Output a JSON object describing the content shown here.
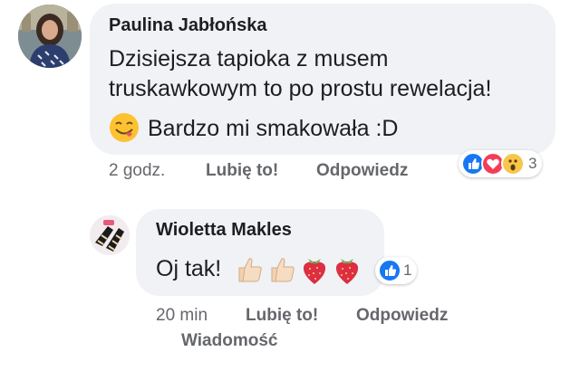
{
  "comment": {
    "author": "Paulina Jabłońska",
    "text_line1": "Dzisiejsza tapioka z musem",
    "text_line2": "truskawkowym to po prostu rewelacja!",
    "text_line3": "Bardzo mi smakowała :D",
    "time": "2 godz.",
    "like_label": "Lubię to!",
    "reply_label": "Odpowiedz",
    "reaction_count": "3",
    "reactions": [
      "like-icon",
      "love-icon",
      "wow-icon"
    ]
  },
  "reply": {
    "author": "Wioletta Makles",
    "text": "Oj tak!",
    "time": "20 min",
    "like_label": "Lubię to!",
    "reply_label": "Odpowiedz",
    "message_label": "Wiadomość",
    "reaction_count": "1",
    "reactions": [
      "like-icon"
    ]
  },
  "colors": {
    "bubble": "#f0f2f5",
    "like_blue": "#1877f2",
    "love_red": "#f33e58",
    "wow_yellow": "#f7c64b",
    "meta_grey": "#65676b"
  }
}
